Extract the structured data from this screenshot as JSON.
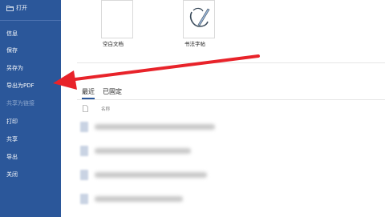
{
  "sidebar": {
    "open_label": "打开",
    "items": [
      {
        "label": "信息"
      },
      {
        "label": "保存"
      },
      {
        "label": "另存为"
      },
      {
        "label": "导出为PDF"
      },
      {
        "label": "共享为链接"
      },
      {
        "label": "打印"
      },
      {
        "label": "共享"
      },
      {
        "label": "导出"
      },
      {
        "label": "关闭"
      }
    ]
  },
  "templates": [
    {
      "label": "空白文档"
    },
    {
      "label": "书法字帖"
    }
  ],
  "recent": {
    "tabs": [
      {
        "label": "最近"
      },
      {
        "label": "已固定"
      }
    ],
    "column_header": "名称"
  },
  "colors": {
    "sidebar_bg": "#2b579a",
    "annotation_arrow": "#e8232a"
  }
}
